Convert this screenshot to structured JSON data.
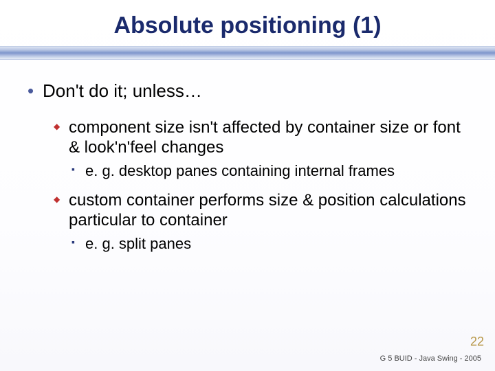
{
  "title": "Absolute positioning (1)",
  "bullets": {
    "main": "Don't do it; unless…",
    "sub1": "component size isn't affected by container size or font & look'n'feel changes",
    "sub1_ex": "e. g. desktop panes containing internal frames",
    "sub2": "custom container performs size & position calculations particular to container",
    "sub2_ex": "e. g. split panes"
  },
  "page_number": "22",
  "footer": "G 5 BUID - Java Swing - 2005"
}
